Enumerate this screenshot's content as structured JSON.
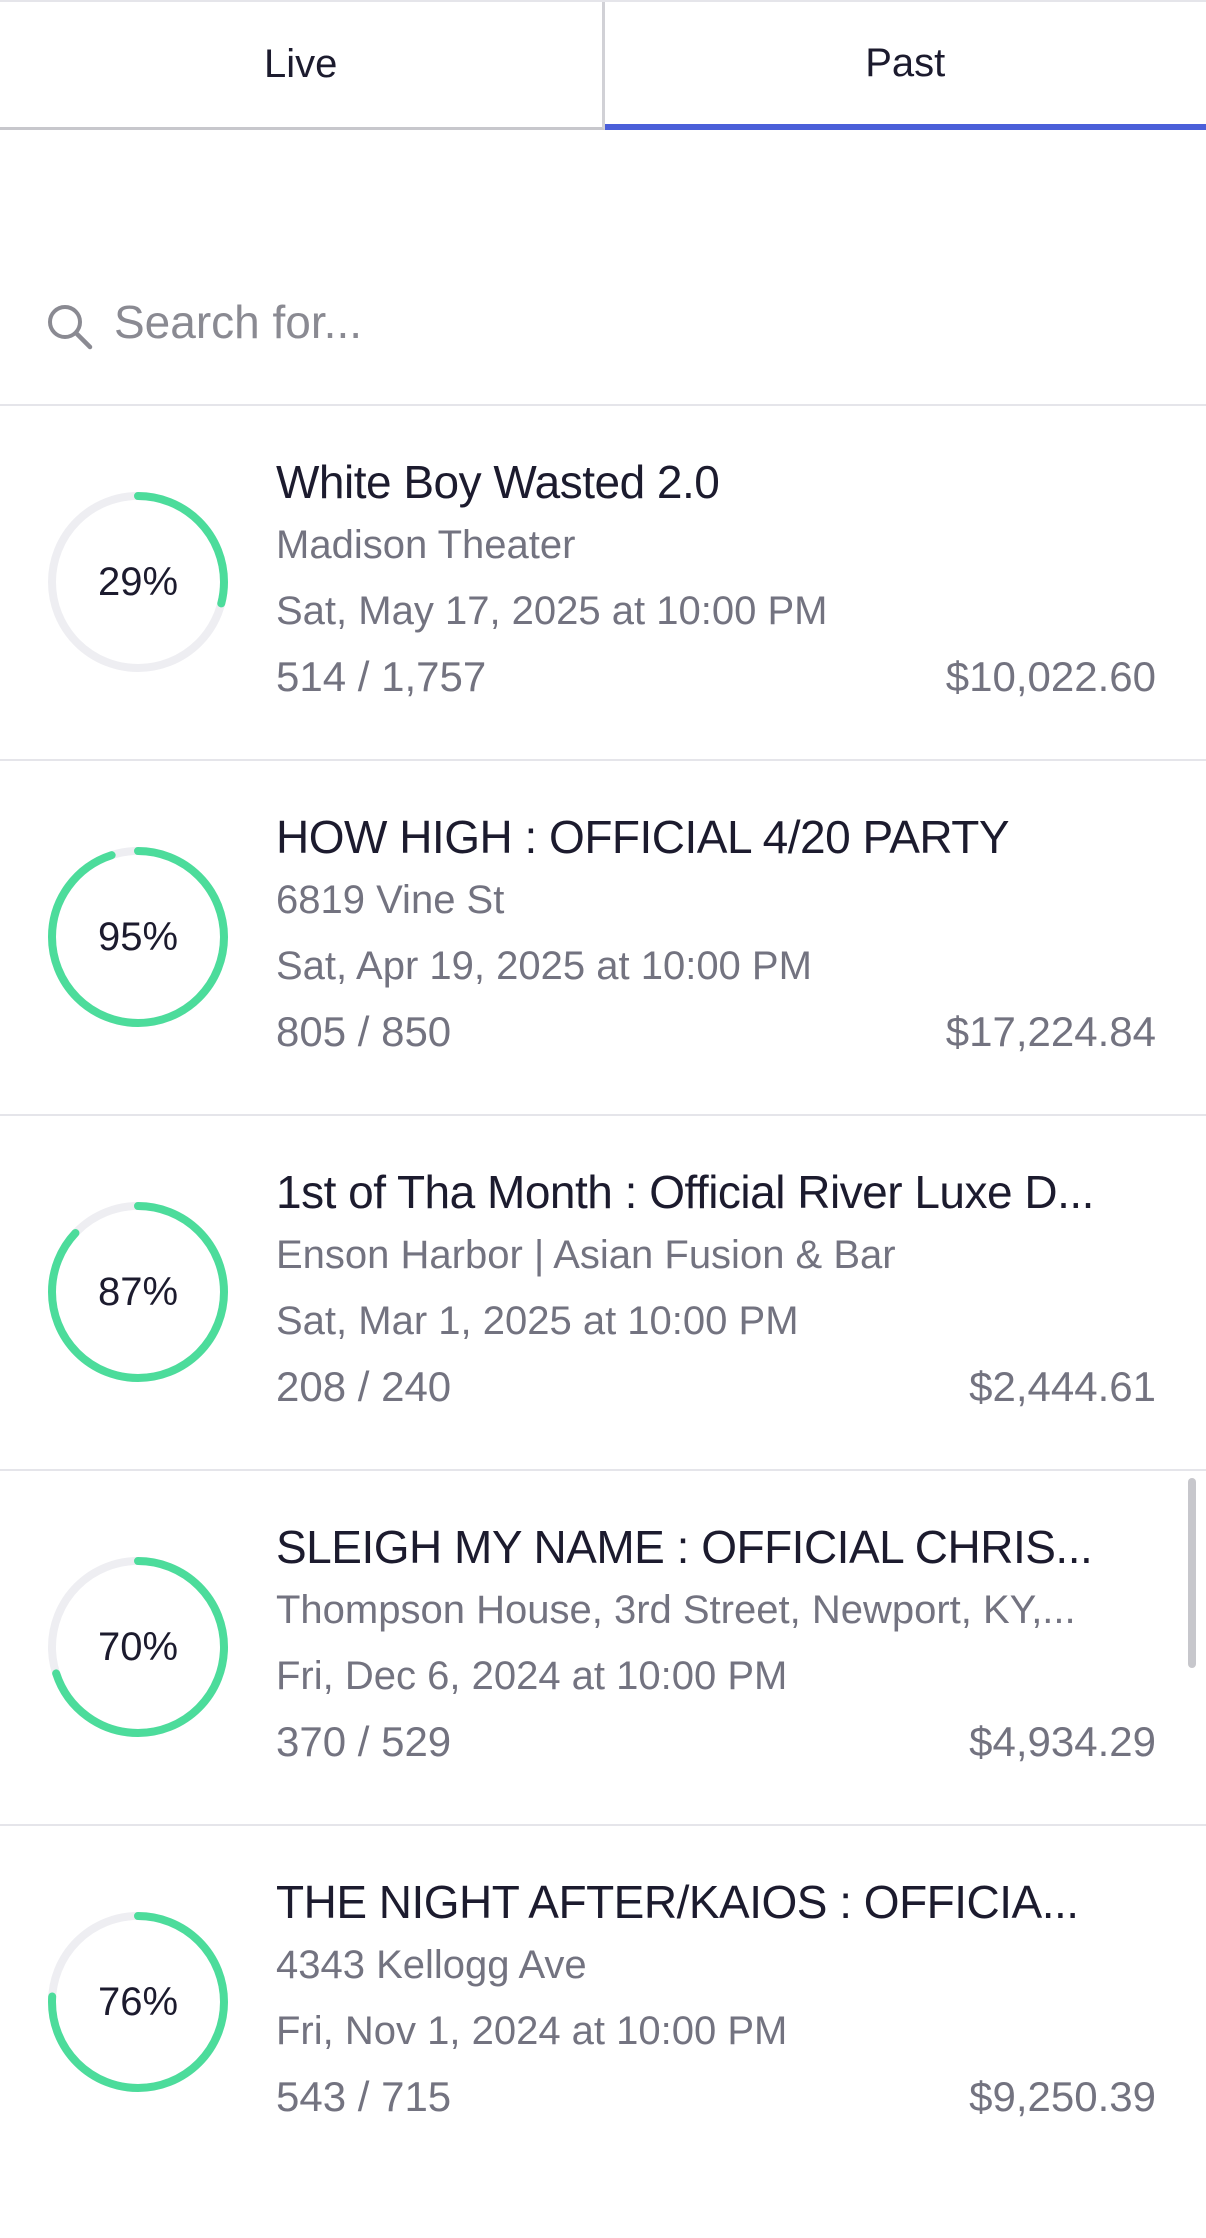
{
  "tabs": [
    {
      "label": "Live",
      "active": false
    },
    {
      "label": "Past",
      "active": true
    }
  ],
  "search": {
    "placeholder": "Search for...",
    "value": ""
  },
  "colors": {
    "accent": "#4b5fd9",
    "progress": "#4cdc9b",
    "track": "#eeeef2",
    "text_primary": "#1c1b2e",
    "text_secondary": "#737380"
  },
  "events": [
    {
      "percent": 0.29,
      "percent_label": "29%",
      "title": "White Boy Wasted 2.0",
      "venue": "Madison Theater",
      "date": "Sat, May 17, 2025 at 10:00 PM",
      "tickets": "514 / 1,757",
      "revenue": "$10,022.60"
    },
    {
      "percent": 0.95,
      "percent_label": "95%",
      "title": "HOW HIGH : OFFICIAL 4/20 PARTY",
      "venue": "6819 Vine St",
      "date": "Sat, Apr 19, 2025 at 10:00 PM",
      "tickets": "805 / 850",
      "revenue": "$17,224.84"
    },
    {
      "percent": 0.87,
      "percent_label": "87%",
      "title": "1st of Tha Month : Official River Luxe D...",
      "venue": "Enson Harbor | Asian Fusion & Bar",
      "date": "Sat, Mar 1, 2025 at 10:00 PM",
      "tickets": "208 / 240",
      "revenue": "$2,444.61"
    },
    {
      "percent": 0.7,
      "percent_label": "70%",
      "title": "SLEIGH MY NAME : OFFICIAL CHRIS...",
      "venue": "Thompson House, 3rd Street, Newport, KY,...",
      "date": "Fri, Dec 6, 2024 at 10:00 PM",
      "tickets": "370 / 529",
      "revenue": "$4,934.29"
    },
    {
      "percent": 0.76,
      "percent_label": "76%",
      "title": "THE NIGHT AFTER/KAIOS : OFFICIA...",
      "venue": "4343 Kellogg Ave",
      "date": "Fri, Nov 1, 2024 at 10:00 PM",
      "tickets": "543 / 715",
      "revenue": "$9,250.39"
    }
  ]
}
